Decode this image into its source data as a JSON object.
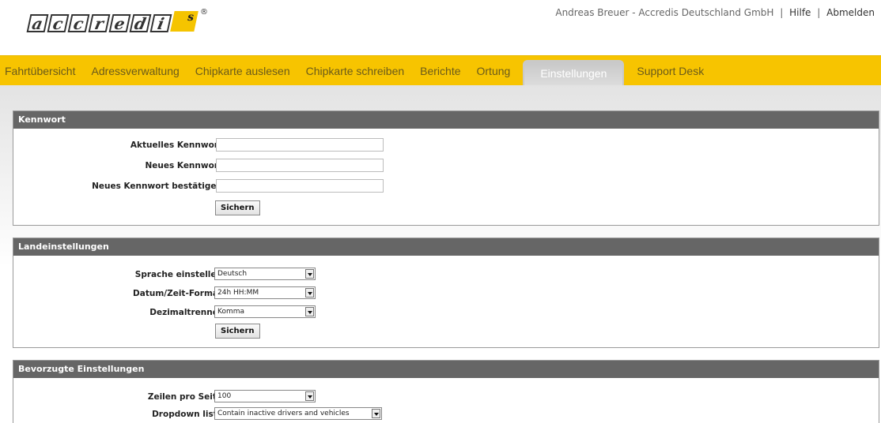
{
  "logo": {
    "letters": [
      "a",
      "c",
      "c",
      "r",
      "e",
      "d",
      "i"
    ],
    "badge_letter": "s",
    "registered": "®"
  },
  "header": {
    "user": "Andreas Breuer - Accredis Deutschland GmbH",
    "help": "Hilfe",
    "logout": "Abmelden",
    "sep": "|"
  },
  "nav": {
    "items": [
      "Fahrtübersicht",
      "Adressverwaltung",
      "Chipkarte auslesen",
      "Chipkarte schreiben",
      "Berichte",
      "Ortung",
      "Einstellungen",
      "Support Desk"
    ],
    "active": "Einstellungen"
  },
  "password": {
    "title": "Kennwort",
    "current_label": "Aktuelles Kennwort",
    "new_label": "Neues Kennwort",
    "confirm_label": "Neues Kennwort bestätigen",
    "save": "Sichern"
  },
  "locale": {
    "title": "Landeinstellungen",
    "language_label": "Sprache einstellen",
    "language_value": "Deutsch",
    "datetime_label": "Datum/Zeit-Format",
    "datetime_value": "24h HH:MM",
    "decimal_label": "Dezimaltrenner",
    "decimal_value": "Komma",
    "save": "Sichern"
  },
  "preferences": {
    "title": "Bevorzugte Einstellungen",
    "rows_label": "Zeilen pro Seite",
    "rows_value": "100",
    "dropdown_label": "Dropdown lists",
    "dropdown_value": "Contain inactive drivers and vehicles"
  },
  "colors": {
    "nav_bg": "#f7c400",
    "panel_header": "#666666",
    "logo_accent": "#f5c400"
  }
}
